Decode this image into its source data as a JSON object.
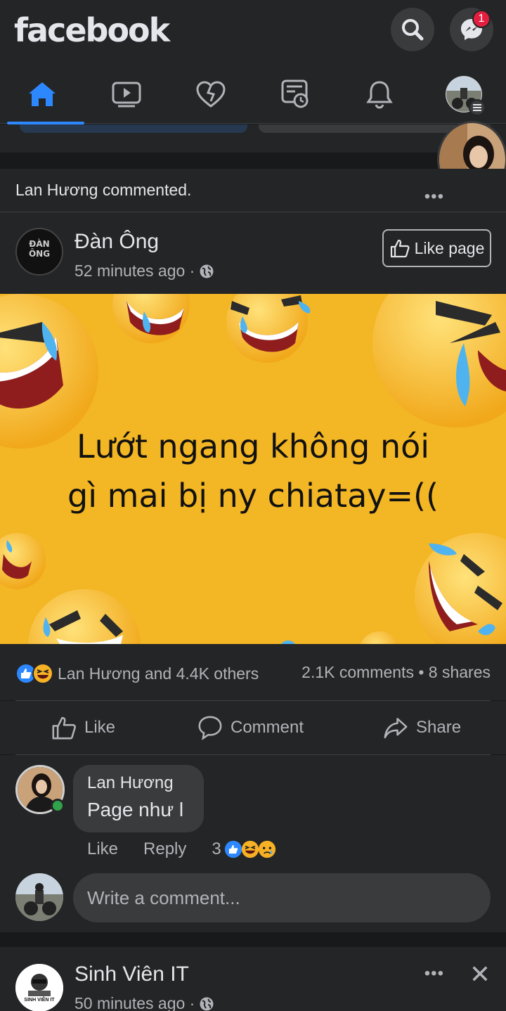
{
  "header": {
    "logo": "facebook",
    "messenger_badge": "1"
  },
  "nav": {
    "tabs": [
      {
        "name": "home",
        "active": true
      },
      {
        "name": "watch",
        "active": false
      },
      {
        "name": "dating",
        "active": false
      },
      {
        "name": "memories",
        "active": false
      },
      {
        "name": "notifications",
        "active": false
      },
      {
        "name": "menu",
        "active": false
      }
    ]
  },
  "post": {
    "activity_name": "Lan Hương",
    "activity_text": " commented.",
    "page_name": "Đàn Ông",
    "page_avatar_text_1": "ĐÀN",
    "page_avatar_text_2": "ÔNG",
    "time": "52 minutes ago ·",
    "like_page_label": "Like page",
    "image_text_line1": "Lướt ngang không nói",
    "image_text_line2": "gì mai bị ny chiatay=((",
    "reactions_text": "Lan Hương and 4.4K others",
    "comments_shares": "2.1K comments • 8 shares",
    "actions": {
      "like": "Like",
      "comment": "Comment",
      "share": "Share"
    }
  },
  "comment": {
    "author": "Lan Hương",
    "text": "Page như l",
    "like": "Like",
    "reply": "Reply",
    "reaction_count": "3"
  },
  "write_comment_placeholder": "Write a comment...",
  "next_post": {
    "page_name": "Sinh Viên IT",
    "time": "50 minutes ago ·",
    "avatar_text": "SINH VIÊN IT"
  },
  "colors": {
    "background": "#18191a",
    "card": "#242526",
    "accent": "#2d88ff",
    "badge": "#e41e3f",
    "image_bg": "#f3b624"
  }
}
